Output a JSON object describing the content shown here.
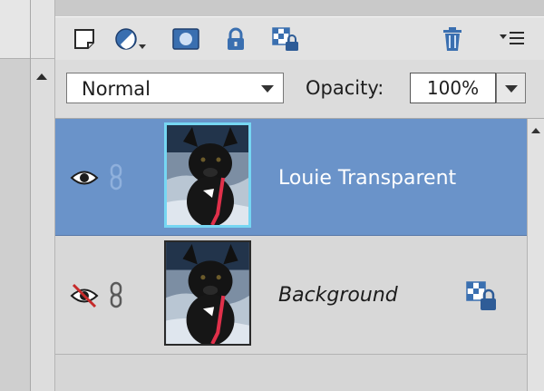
{
  "toolbar": {
    "icons": [
      "new-layer-icon",
      "fill-adjustment-layer-icon",
      "layer-mask-icon",
      "lock-all-icon",
      "lock-transparency-icon",
      "delete-layer-icon",
      "panel-menu-icon"
    ]
  },
  "blend": {
    "mode": "Normal",
    "opacity_label": "Opacity:",
    "opacity_value": "100%"
  },
  "layers": [
    {
      "name": "Louie Transparent",
      "visible": true,
      "selected": true,
      "locked_transparency": false
    },
    {
      "name": "Background",
      "visible": false,
      "selected": false,
      "locked_transparency": true
    }
  ],
  "colors": {
    "selected_row": "#6a93c9",
    "thumb_highlight": "#76d6f2",
    "icon_blue": "#3a6fb0",
    "hidden_slash": "#c62a2a"
  }
}
